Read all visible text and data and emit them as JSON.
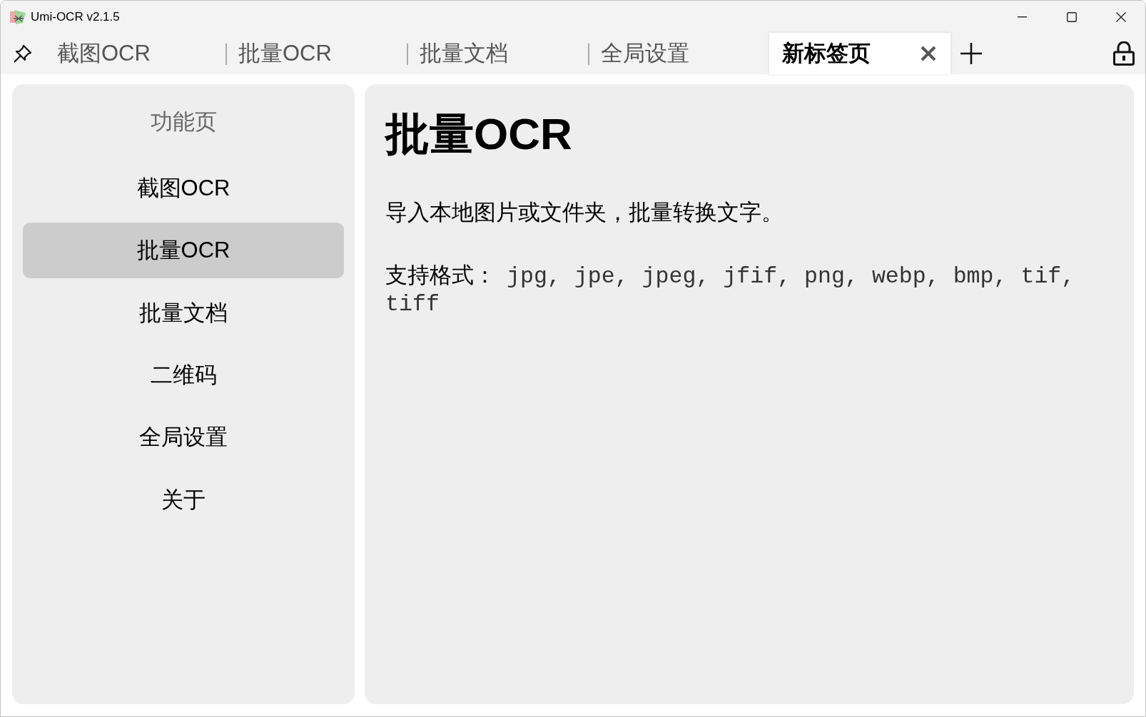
{
  "window": {
    "title": "Umi-OCR v2.1.5"
  },
  "tabs": [
    {
      "label": "截图OCR",
      "selected": false
    },
    {
      "label": "批量OCR",
      "selected": false
    },
    {
      "label": "批量文档",
      "selected": false
    },
    {
      "label": "全局设置",
      "selected": false
    },
    {
      "label": "新标签页",
      "selected": true
    }
  ],
  "sidebar": {
    "title": "功能页",
    "items": [
      {
        "label": "截图OCR",
        "selected": false
      },
      {
        "label": "批量OCR",
        "selected": true
      },
      {
        "label": "批量文档",
        "selected": false
      },
      {
        "label": "二维码",
        "selected": false
      },
      {
        "label": "全局设置",
        "selected": false
      },
      {
        "label": "关于",
        "selected": false
      }
    ]
  },
  "content": {
    "title": "批量OCR",
    "description": "导入本地图片或文件夹，批量转换文字。",
    "formats_label": "支持格式：",
    "formats": "jpg, jpe, jpeg, jfif, png, webp, bmp, tif, tiff"
  }
}
